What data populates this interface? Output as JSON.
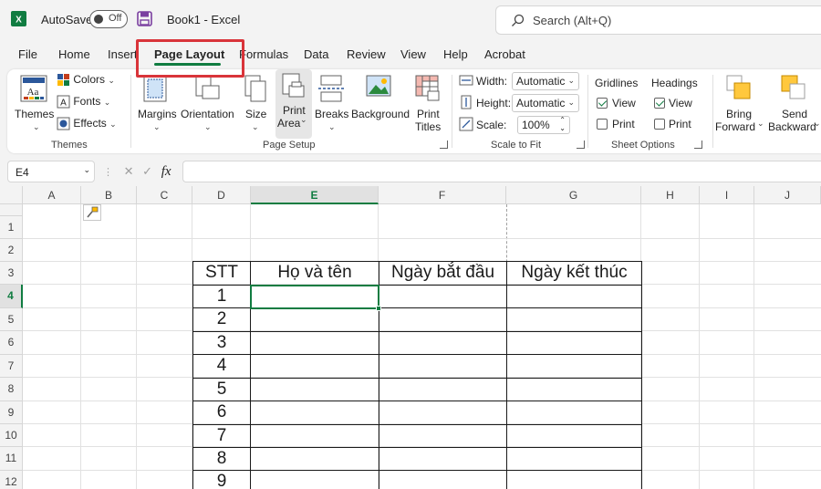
{
  "titlebar": {
    "autosave_label": "AutoSave",
    "autosave_state": "Off",
    "document_title": "Book1  -  Excel",
    "search_placeholder": "Search (Alt+Q)"
  },
  "tabs": [
    {
      "label": "File"
    },
    {
      "label": "Home"
    },
    {
      "label": "Insert"
    },
    {
      "label": "Page Layout",
      "active": true
    },
    {
      "label": "Formulas"
    },
    {
      "label": "Data"
    },
    {
      "label": "Review"
    },
    {
      "label": "View"
    },
    {
      "label": "Help"
    },
    {
      "label": "Acrobat"
    }
  ],
  "ribbon": {
    "themes": {
      "themes_label": "Themes",
      "colors_label": "Colors",
      "fonts_label": "Fonts",
      "effects_label": "Effects",
      "group_label": "Themes"
    },
    "page_setup": {
      "margins_label": "Margins",
      "orientation_label": "Orientation",
      "size_label": "Size",
      "print_area_line1": "Print",
      "print_area_line2": "Area",
      "breaks_label": "Breaks",
      "background_label": "Background",
      "print_titles_line1": "Print",
      "print_titles_line2": "Titles",
      "group_label": "Page Setup"
    },
    "scale_to_fit": {
      "width_label": "Width:",
      "width_value": "Automatic",
      "height_label": "Height:",
      "height_value": "Automatic",
      "scale_label": "Scale:",
      "scale_value": "100%",
      "group_label": "Scale to Fit"
    },
    "sheet_options": {
      "gridlines_label": "Gridlines",
      "headings_label": "Headings",
      "gridlines_view_label": "View",
      "gridlines_print_label": "Print",
      "headings_view_label": "View",
      "headings_print_label": "Print",
      "gridlines_view_checked": true,
      "gridlines_print_checked": false,
      "headings_view_checked": true,
      "headings_print_checked": false,
      "group_label": "Sheet Options"
    },
    "arrange": {
      "bring_forward_line1": "Bring",
      "bring_forward_line2": "Forward",
      "send_backward_line1": "Send",
      "send_backward_line2": "Backward"
    }
  },
  "formula_bar": {
    "name_box": "E4",
    "fx_label": "fx",
    "formula": ""
  },
  "sheet": {
    "columns": [
      "A",
      "B",
      "C",
      "D",
      "E",
      "F",
      "G",
      "H",
      "I",
      "J"
    ],
    "selected_column": "E",
    "rows": [
      "1",
      "2",
      "3",
      "4",
      "5",
      "6",
      "7",
      "8",
      "9",
      "10",
      "11",
      "12"
    ],
    "selected_row": "4",
    "table_headers": [
      "STT",
      "Họ và tên",
      "Ngày bắt đầu",
      "Ngày kết thúc"
    ],
    "stt_values": [
      "1",
      "2",
      "3",
      "4",
      "5",
      "6",
      "7",
      "8",
      "9"
    ]
  },
  "colors": {
    "excel_green": "#107c41",
    "highlight_red": "#d9343a"
  }
}
